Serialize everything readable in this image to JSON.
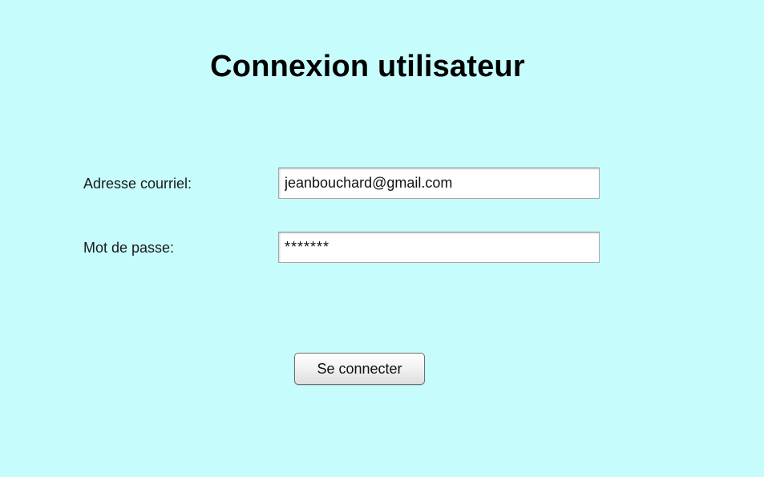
{
  "page": {
    "title": "Connexion utilisateur",
    "background_color": "#c6fcfc"
  },
  "form": {
    "email_label": "Adresse courriel:",
    "email_value": "jeanbouchard@gmail.com",
    "password_label": "Mot de passe:",
    "password_value": "*******",
    "submit_label": "Se connecter"
  }
}
